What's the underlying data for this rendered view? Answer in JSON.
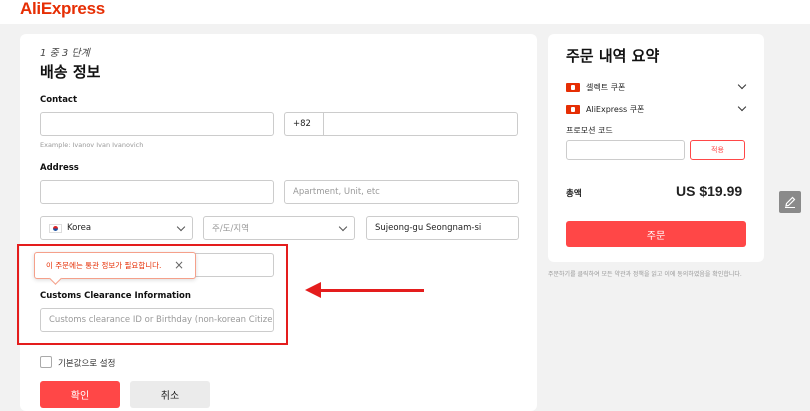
{
  "header": {
    "logo": "AliExpress"
  },
  "form": {
    "step": "1 중 3 단계",
    "title": "배송 정보",
    "contact_label": "Contact",
    "phone_code": "+82",
    "name_hint": "Example: Ivanov Ivan Ivanovich",
    "address_label": "Address",
    "address2_placeholder": "Apartment, Unit, etc",
    "country": "Korea",
    "region_placeholder": "주/도/지역",
    "city": "Sujeong-gu Seongnam-si",
    "tooltip_text": "이 주문에는 통관 정보가 필요합니다.",
    "tooltip_close": "×",
    "customs_label": "Customs Clearance Information",
    "customs_placeholder": "Customs clearance ID or Birthday (non-korean Citizens",
    "default_label": "기본값으로 설정",
    "confirm_label": "확인",
    "cancel_label": "취소"
  },
  "summary": {
    "title": "주문 내역 요약",
    "coupon1": "셀렉트 쿠폰",
    "coupon2": "AliExpress 쿠폰",
    "promo_label": "프로모션 코드",
    "apply_label": "적용",
    "total_label": "총액",
    "total_value": "US $19.99",
    "order_label": "주문",
    "disclaimer": "주문하기를 클릭하여 모든 약관과 정책을 읽고 이에 동의하였음을 확인합니다."
  },
  "colors": {
    "accent": "#ff4747",
    "annotation": "#e41d1d"
  },
  "icons": {
    "close": "close-icon",
    "edit": "pencil-icon"
  }
}
